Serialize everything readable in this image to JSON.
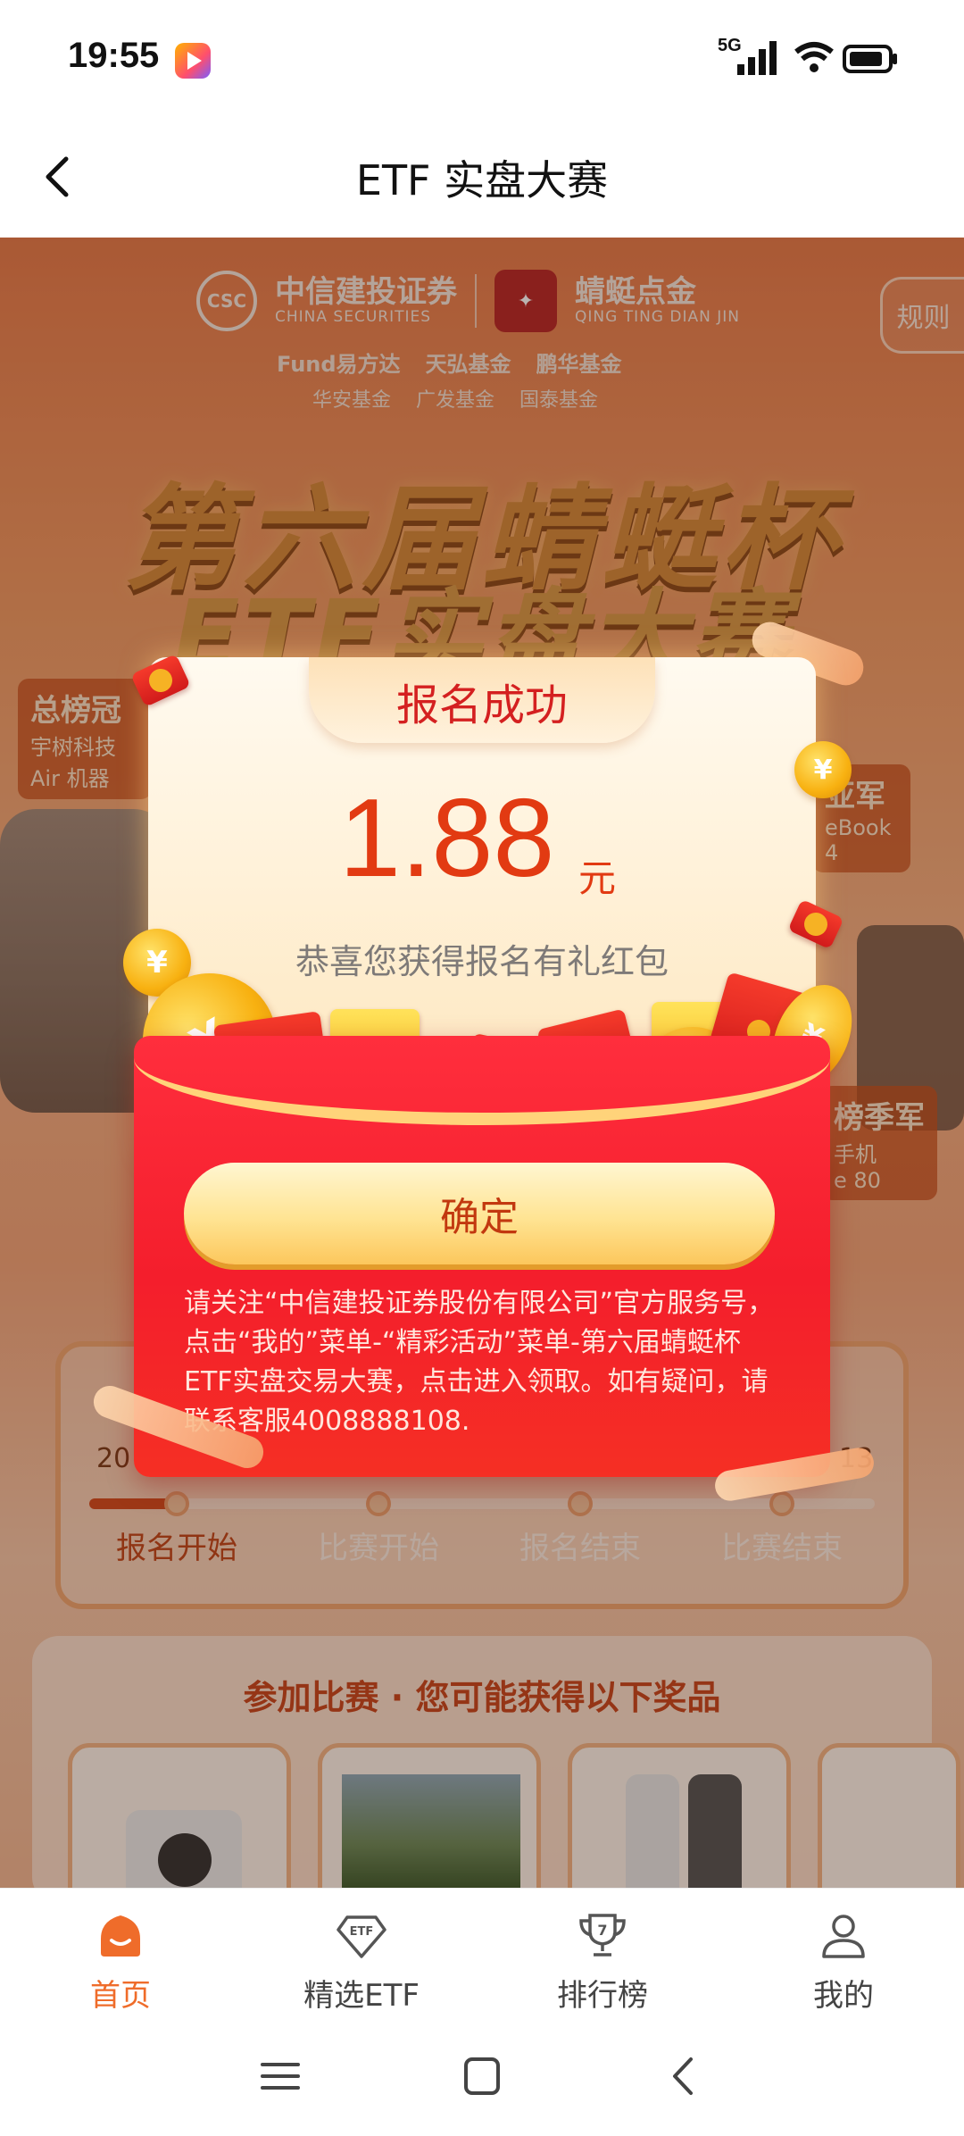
{
  "status_bar": {
    "time": "19:55",
    "network": "5G"
  },
  "nav": {
    "title": "ETF 实盘大赛"
  },
  "banner": {
    "sponsor_1_cn": "中信建投证券",
    "sponsor_1_en": "CHINA SECURITIES",
    "sponsor_2_cn": "蜻蜓点金",
    "sponsor_2_en": "QING TING DIAN JIN",
    "funds_row_1": [
      "Fund易方达",
      "天弘基金",
      "鹏华基金"
    ],
    "funds_row_2": [
      "华安基金",
      "广发基金",
      "国泰基金"
    ],
    "rules_label": "规则",
    "hero_line_1": "第六届蜻蜓杯",
    "hero_line_2": "ETF实盘大赛"
  },
  "prize_tags": {
    "left_title": "总榜冠",
    "left_sub_1": "宇树科技",
    "left_sub_2": "Air 机器",
    "right_title": "亚军",
    "right_sub_1": "eBook",
    "right_sub_2": "4",
    "right2_title": "榜季军",
    "right2_sub_1": "手机",
    "right2_sub_2": "e 80"
  },
  "timeline": {
    "date_left": "20",
    "date_right": "13",
    "stages": [
      "报名开始",
      "比赛开始",
      "报名结束",
      "比赛结束"
    ]
  },
  "prizes": {
    "title": "参加比赛 · 您可能获得以下奖品"
  },
  "modal": {
    "title": "报名成功",
    "amount": "1.88",
    "unit": "元",
    "description": "恭喜您获得报名有礼红包",
    "confirm_label": "确定",
    "notice": "请关注“中信建投证券股份有限公司”官方服务号，点击“我的”菜单-“精彩活动”菜单-第六届蜻蜓杯ETF实盘交易大赛，点击进入领取。如有疑问，请联系客服4008888108."
  },
  "tabs": [
    {
      "label": "首页",
      "icon": "home-icon",
      "active": true
    },
    {
      "label": "精选ETF",
      "icon": "etf-diamond-icon",
      "active": false
    },
    {
      "label": "排行榜",
      "icon": "trophy-icon",
      "active": false
    },
    {
      "label": "我的",
      "icon": "person-icon",
      "active": false
    }
  ],
  "colors": {
    "accent": "#EF6C2A",
    "envelope_red": "#F41E2C",
    "amount_red": "#E23A12"
  }
}
